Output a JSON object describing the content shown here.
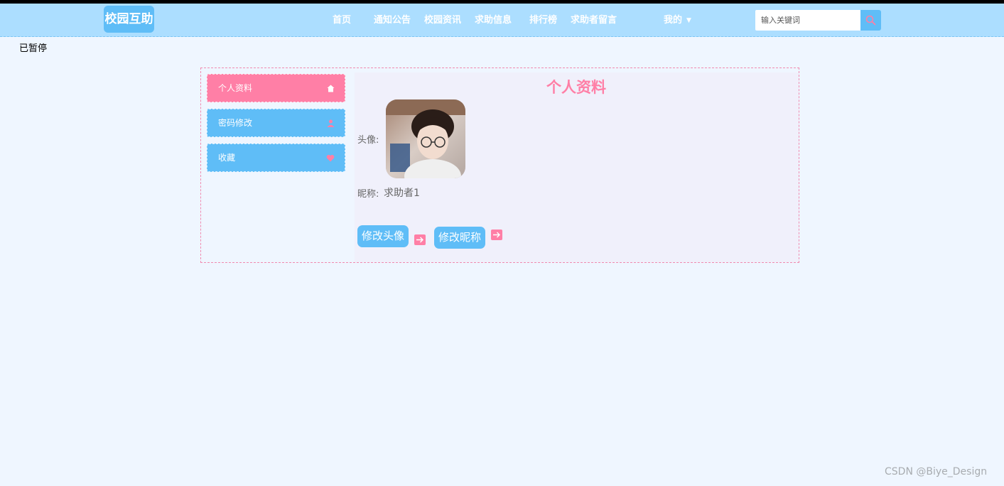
{
  "site": {
    "logo": "校园互助"
  },
  "nav": {
    "items": [
      "首页",
      "通知公告",
      "校园资讯",
      "求助信息",
      "排行榜",
      "求助者留言"
    ],
    "mine": "我的"
  },
  "search": {
    "placeholder": "输入关键词",
    "icon": "search-icon"
  },
  "overlay": {
    "paused": "已暂停"
  },
  "sidebar": {
    "items": [
      {
        "label": "个人资料",
        "icon": "home-icon",
        "active": true
      },
      {
        "label": "密码修改",
        "icon": "user-icon",
        "active": false
      },
      {
        "label": "收藏",
        "icon": "heart-icon",
        "active": false
      }
    ]
  },
  "profile": {
    "title": "个人资料",
    "avatar_label": "头像:",
    "nickname_label": "昵称:",
    "nickname_value": "求助者1",
    "change_avatar_button": "修改头像",
    "change_nickname_button": "修改昵称"
  },
  "watermark": "CSDN @Biye_Design",
  "colors": {
    "navbar": "#acdeff",
    "primary_blue": "#5fbdf7",
    "accent_pink": "#ff7fa6",
    "page_bg": "#eff6ff"
  }
}
